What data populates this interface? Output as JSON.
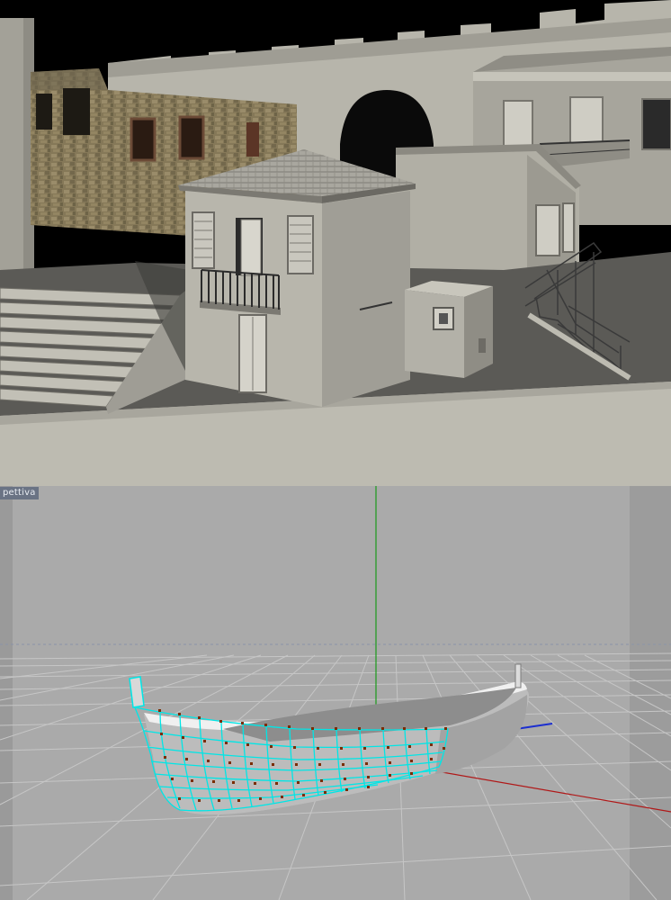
{
  "viewport": {
    "label": "pettiva",
    "colors": {
      "background": "#a9a9a9",
      "grid": "#c8c8c8",
      "horizon": "#8a93a8",
      "axis_y": "#1a9a1a",
      "axis_x": "#b01818",
      "axis_z": "#1c2fd0",
      "selection": "#00e6e6",
      "vertex": "#7a2c00",
      "boat": "#d4d4d4"
    }
  },
  "render": {
    "colors": {
      "sky": "#000000",
      "wall": "#b3b1a7",
      "wall_shadow": "#8d8b83",
      "ground": "#5a5955",
      "quay": "#bdbbb1",
      "stone": "#8a7d5e"
    }
  }
}
